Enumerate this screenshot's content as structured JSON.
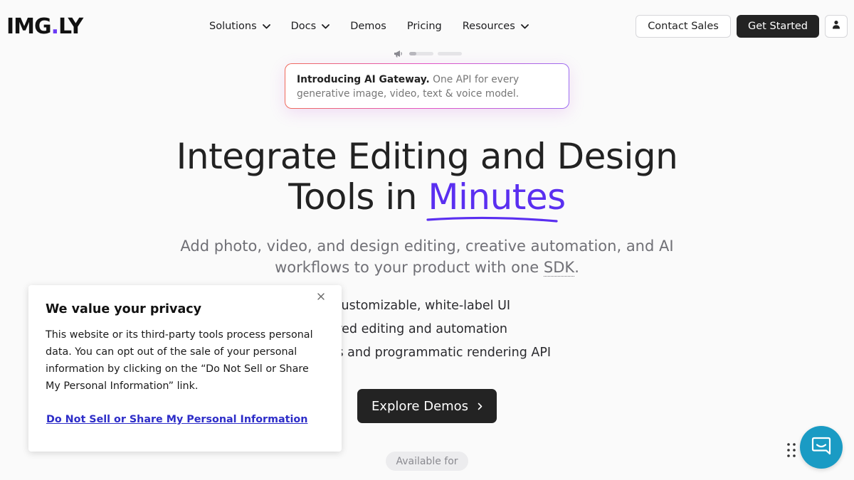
{
  "header": {
    "logo": {
      "text_main": "IMG",
      "dot": ".",
      "text_end": "LY"
    },
    "nav": [
      {
        "label": "Solutions",
        "has_dropdown": true
      },
      {
        "label": "Docs",
        "has_dropdown": true
      },
      {
        "label": "Demos",
        "has_dropdown": false
      },
      {
        "label": "Pricing",
        "has_dropdown": false
      },
      {
        "label": "Resources",
        "has_dropdown": true
      }
    ],
    "contact_label": "Contact Sales",
    "start_label": "Get Started",
    "user_icon": "user-icon"
  },
  "announcement": {
    "lead": "Introducing AI Gateway.",
    "text": "One API for every generative image, video, text & voice model.",
    "slides": [
      {
        "progress": 0.3
      },
      {
        "progress": 0
      }
    ]
  },
  "hero": {
    "title_line1": "Integrate Editing and Design",
    "title_line2_pre": "Tools in",
    "title_accent": "Minutes",
    "subtitle_pre": "Add photo, video, and design editing, creative automation, and AI workflows to your product with one",
    "subtitle_sdk": "SDK",
    "subtitle_post": ".",
    "features": [
      "Deeply customizable, white-label UI",
      "AI-powered editing and automation",
      "Headless and programmatic rendering API"
    ],
    "explore_label": "Explore Demos",
    "available_label": "Available for"
  },
  "privacy": {
    "title": "We value your privacy",
    "body": "This website or its third-party tools process personal data. You can opt out of the sale of your personal information by clicking on the “Do Not Sell or Share My Personal Information” link.",
    "optout_label": "Do Not Sell or Share My Personal Information"
  },
  "colors": {
    "accent": "#5a2ff0",
    "dark_button": "#232323",
    "chat": "#1a9bc4",
    "link": "#2d2dc8"
  }
}
